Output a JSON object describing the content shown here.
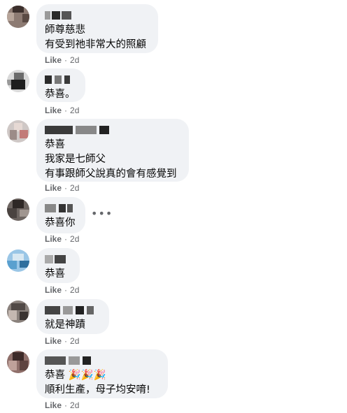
{
  "comments": [
    {
      "lines": [
        "師尊慈悲",
        "有受到祂非常大的照顧"
      ],
      "like": "Like",
      "time": "2d"
    },
    {
      "lines": [
        "恭喜。"
      ],
      "like": "Like",
      "time": "2d"
    },
    {
      "lines": [
        "恭喜",
        "我家是七師父",
        "有事跟師父說真的會有感覺到"
      ],
      "like": "Like",
      "time": "2d"
    },
    {
      "lines": [
        "恭喜你"
      ],
      "like": "Like",
      "time": "2d"
    },
    {
      "lines": [
        "恭喜"
      ],
      "like": "Like",
      "time": "2d"
    },
    {
      "lines": [
        "就是神蹟"
      ],
      "like": "Like",
      "time": "2d"
    },
    {
      "lines": [
        "恭喜 🎉🎉🎉",
        "順利生產，母子均安唷!"
      ],
      "like": "Like",
      "time": "2d"
    }
  ],
  "icons": {
    "more": "more-options-icon",
    "celebrate": "party-popper-icon"
  },
  "separator": "·"
}
